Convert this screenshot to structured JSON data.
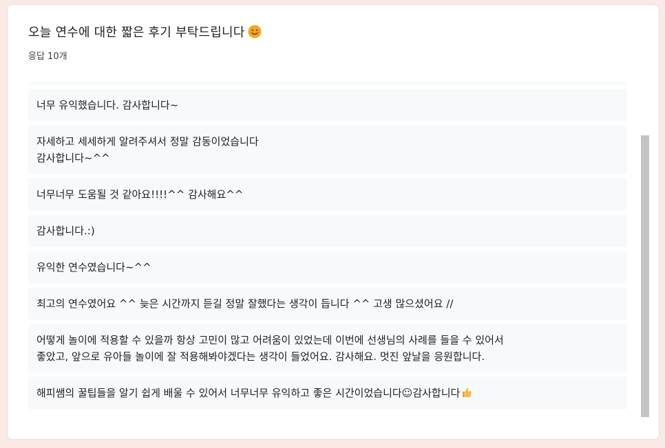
{
  "header": {
    "title": "오늘 연수에 대한 짧은 후기 부탁드립니다",
    "response_count": "응답 10개"
  },
  "responses": [
    "",
    "너무 유익했습니다. 감사합니다~",
    "자세하고 세세하게 알려주셔서 정말 감동이었습니다",
    "감사합니다~^^",
    "너무너무 도움될 것 같아요!!!!^^ 감사해요^^",
    "감사합니다.:)",
    "유익한 연수였습니다~^^",
    "최고의 연수였어요 ^^ 늦은 시간까지 듣길 정말 잘했다는 생각이 듭니다 ^^ 고생 많으셨어요 //",
    "어떻게 놀이에 적용할 수 있을까 항상 고민이 많고 어려움이 있었는데 이번에 선생님의 사례를 들을 수 있어서",
    "좋았고, 앞으로 유아들 놀이에 잘 적용해봐야겠다는 생각이 들었어요. 감사해요. 멋진 앞날을 응원합니다.",
    "해피쌤의 꿀팁들을 알기 쉽게 배울 수 있어서 너무너무 유익하고 좋은 시간이었습니다☺감사합니다"
  ],
  "icons": {
    "title_emoji": "smiling-face-icon",
    "last_item_emoji": "thumbs-up-icon"
  },
  "colors": {
    "page_background": "#fbe9e5",
    "card_background": "#ffffff",
    "item_background": "#f8f9fa",
    "scrollbar": "#c4c4c4",
    "emoji": "#f5a623"
  }
}
